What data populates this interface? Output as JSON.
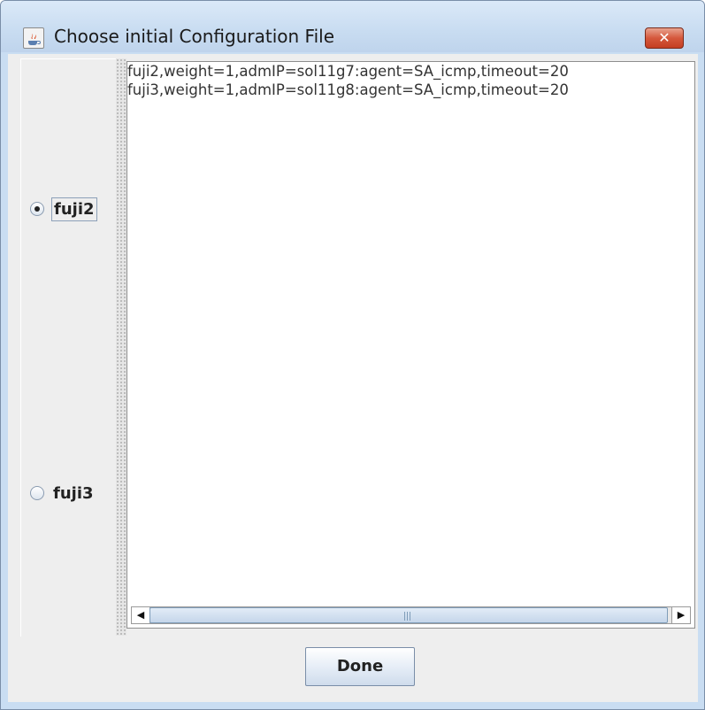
{
  "window": {
    "title": "Choose initial Configuration File",
    "close_glyph": "✕",
    "app_icon": "java-cup-icon"
  },
  "nodes": [
    {
      "label": "fuji2",
      "checked": true
    },
    {
      "label": "fuji3",
      "checked": false
    }
  ],
  "config_text": {
    "lines": [
      "fuji2,weight=1,admIP=sol11g7:agent=SA_icmp,timeout=20",
      "fuji3,weight=1,admIP=sol11g8:agent=SA_icmp,timeout=20"
    ]
  },
  "scrollbar": {
    "left_arrow": "◀",
    "right_arrow": "▶"
  },
  "buttons": {
    "done_label": "Done"
  }
}
